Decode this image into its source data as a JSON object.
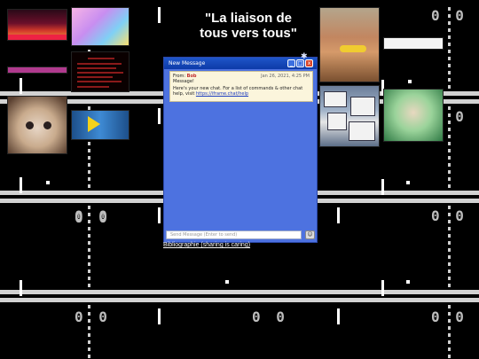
{
  "page": {
    "title_line1": "\"La liaison de",
    "title_line2": "tous vers tous\"",
    "bibliography_link": "Bibliographie (sharing is caring)"
  },
  "pong_scores": [
    "0 0",
    "0 0",
    "0 0",
    "0 0",
    "0 0",
    "0 0",
    "0 0",
    "0 0",
    "0 0",
    "0 0"
  ],
  "images": [
    {
      "name": "concert-image"
    },
    {
      "name": "pony-image"
    },
    {
      "name": "cat-image"
    },
    {
      "name": "logo-image"
    },
    {
      "name": "man-with-corn-image"
    },
    {
      "name": "desktop-collage-image"
    },
    {
      "name": "anime-girl-image"
    }
  ],
  "chat": {
    "window_title": "New Message",
    "controls": [
      "_",
      "□",
      "x"
    ],
    "message": {
      "from_label": "From:",
      "from_name": "Bob",
      "date": "Jan 26, 2021, 4:25 PM",
      "subject": "Message!",
      "body": "Here's your new chat. For a list of commands & other chat help, visit ",
      "link": "https://iframe.chat/help"
    },
    "input_placeholder": "Send Message (Enter to send)",
    "send_icon": "smiley-icon"
  }
}
